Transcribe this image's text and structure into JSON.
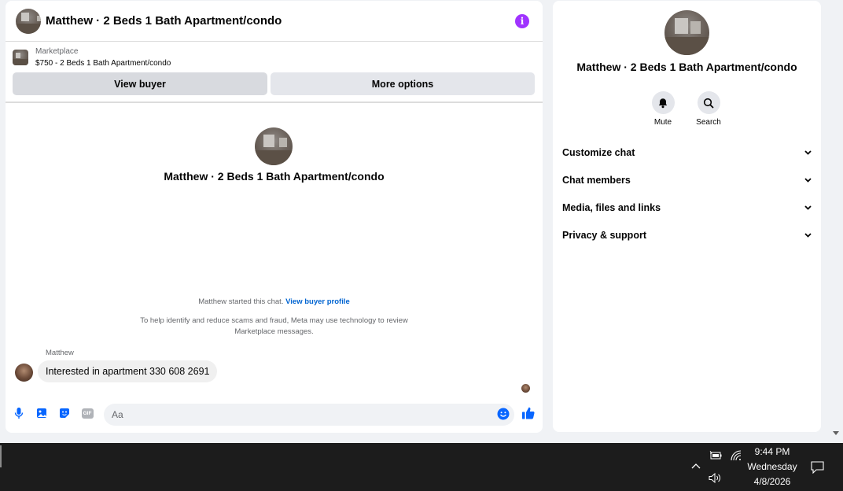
{
  "chat": {
    "title": "Matthew · 2 Beds 1 Bath Apartment/condo",
    "listing_label": "Marketplace",
    "listing_title": "$750 - 2 Beds 1 Bath Apartment/condo",
    "view_buyer": "View buyer",
    "more_options": "More options",
    "intro_title": "Matthew · 2 Beds 1 Bath Apartment/condo",
    "started_text": "Matthew started this chat.",
    "view_buyer_profile": "View buyer profile",
    "notice": "To help identify and reduce scams and fraud, Meta may use technology to review Marketplace messages.",
    "sender": "Matthew",
    "message": "Interested in apartment 330 608 2691",
    "input_placeholder": "Aa",
    "gif_label": "GIF",
    "accent_color": "#0866ff",
    "info_color": "#a033ff",
    "icons": [
      "info-icon",
      "mic-icon",
      "image-icon",
      "sticker-icon",
      "gif-icon",
      "emoji-icon",
      "like-icon"
    ]
  },
  "info_panel": {
    "title": "Matthew · 2 Beds 1 Bath Apartment/condo",
    "mute": "Mute",
    "search": "Search",
    "sections": [
      "Customize chat",
      "Chat members",
      "Media, files and links",
      "Privacy & support"
    ]
  },
  "taskbar": {
    "time": "9:44 PM",
    "day": "Wednesday",
    "date": "4/8/2026",
    "icons": [
      "chevron-up-icon",
      "battery-icon",
      "wifi-icon",
      "volume-icon",
      "notification-icon"
    ]
  }
}
